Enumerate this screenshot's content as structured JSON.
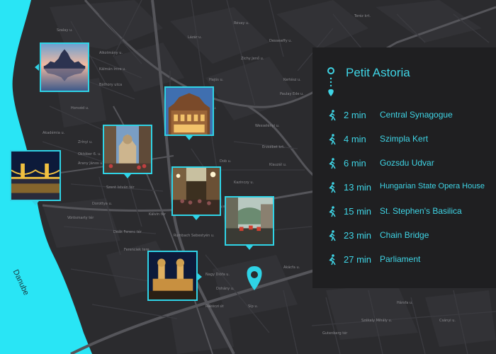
{
  "map": {
    "river_label": "Danube",
    "colors": {
      "water": "#29e5f5",
      "land": "#2b2b2e",
      "accent": "#2fd3e6",
      "panel": "#1f1f21"
    },
    "street_labels": [
      "Szalay u.",
      "Alkotmány u.",
      "Kálmán Imre u.",
      "Báthory utca",
      "Honvéd u.",
      "Akadémia u.",
      "Zrínyi u.",
      "Október 6. u.",
      "Arany János u.",
      "Szent István tér",
      "Dorottya u.",
      "Vörösmarty tér",
      "Ferenciek tere",
      "Deák Ferenc tér",
      "Király u.",
      "Dohány u.",
      "Rumbach Sebestyén u.",
      "Kazinczy u.",
      "Dob u.",
      "Wesselényi u.",
      "Akácfa u.",
      "Klauzál u.",
      "Nagy Diófa u.",
      "Rákóczi út",
      "Erzsébet krt.",
      "Dessewffy u.",
      "Zichy Jenő u.",
      "Hajós u.",
      "Lázár u.",
      "Paulay Ede u.",
      "Révay u.",
      "Teréz krt.",
      "Gutenberg tér",
      "Síp u.",
      "Kertész u.",
      "Hársfa u.",
      "Csányi u.",
      "Székely Mihály u.",
      "Kálvin tér"
    ]
  },
  "photos": [
    {
      "name": "parliament",
      "alt": "Parliament"
    },
    {
      "name": "opera",
      "alt": "Hungarian State Opera House"
    },
    {
      "name": "basilica",
      "alt": "St. Stephen's Basilica"
    },
    {
      "name": "chain-bridge",
      "alt": "Chain Bridge"
    },
    {
      "name": "gozsdu",
      "alt": "Gozsdu Udvar"
    },
    {
      "name": "szimpla",
      "alt": "Szimpla Kert"
    },
    {
      "name": "synagogue",
      "alt": "Central Synagogue"
    }
  ],
  "panel": {
    "title": "Petit Astoria",
    "icons": {
      "origin": "circle-icon",
      "walk": "walking-person-icon",
      "destination": "location-pin-icon"
    },
    "routes": [
      {
        "time": "2 min",
        "name": "Central Synagogue"
      },
      {
        "time": "4 min",
        "name": "Szimpla Kert"
      },
      {
        "time": "6 min",
        "name": "Gozsdu Udvar"
      },
      {
        "time": "13 min",
        "name": "Hungarian State Opera House"
      },
      {
        "time": "15 min",
        "name": "St. Stephen's Basilica"
      },
      {
        "time": "23 min",
        "name": "Chain Bridge"
      },
      {
        "time": "27 min",
        "name": "Parliament"
      }
    ]
  }
}
